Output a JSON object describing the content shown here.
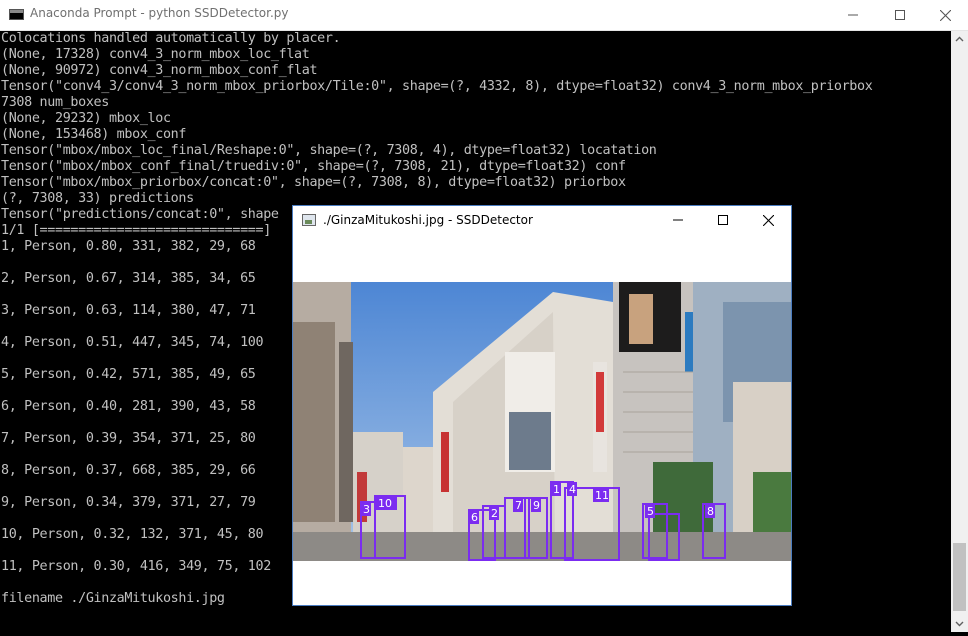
{
  "console": {
    "title": "Anaconda Prompt - python  SSDDetector.py",
    "lines": [
      "Colocations handled automatically by placer.",
      "(None, 17328) conv4_3_norm_mbox_loc_flat",
      "(None, 90972) conv4_3_norm_mbox_conf_flat",
      "Tensor(\"conv4_3/conv4_3_norm_mbox_priorbox/Tile:0\", shape=(?, 4332, 8), dtype=float32) conv4_3_norm_mbox_priorbox",
      "7308 num_boxes",
      "(None, 29232) mbox_loc",
      "(None, 153468) mbox_conf",
      "Tensor(\"mbox/mbox_loc_final/Reshape:0\", shape=(?, 7308, 4), dtype=float32) locatation",
      "Tensor(\"mbox/mbox_conf_final/truediv:0\", shape=(?, 7308, 21), dtype=float32) conf",
      "Tensor(\"mbox/mbox_priorbox/concat:0\", shape=(?, 7308, 8), dtype=float32) priorbox",
      "(?, 7308, 33) predictions",
      "Tensor(\"predictions/concat:0\", shape",
      "1/1 [=============================]",
      "1, Person, 0.80, 331, 382, 29, 68",
      "2, Person, 0.67, 314, 385, 34, 65",
      "3, Person, 0.63, 114, 380, 47, 71",
      "4, Person, 0.51, 447, 345, 74, 100",
      "5, Person, 0.42, 571, 385, 49, 65",
      "6, Person, 0.40, 281, 390, 43, 58",
      "7, Person, 0.39, 354, 371, 25, 80",
      "8, Person, 0.37, 668, 385, 29, 66",
      "9, Person, 0.34, 379, 371, 27, 79",
      "10, Person, 0.32, 132, 371, 45, 80",
      "11, Person, 0.30, 416, 349, 75, 102",
      "filename ./GinzaMitukoshi.jpg"
    ]
  },
  "image_window": {
    "title": "./GinzaMitukoshi.jpg - SSDDetector",
    "detections": [
      "10",
      "3",
      "6",
      "2",
      "7",
      "9",
      "1",
      "4",
      "5",
      "8",
      "11"
    ],
    "box_color": "#7b2cf0",
    "sky_color": "#5b8ed6"
  },
  "icons": [
    "console-app-icon",
    "minimize-icon",
    "maximize-icon",
    "close-icon",
    "scroll-up-icon",
    "scroll-down-icon",
    "image-app-icon"
  ]
}
